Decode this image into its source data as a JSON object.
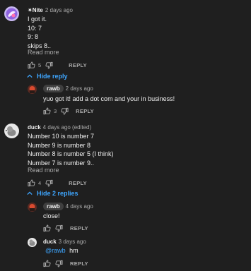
{
  "comments": [
    {
      "author": "✷Nite",
      "time": "2 days ago",
      "lines": [
        "I got it.",
        "10: 7",
        "9: 8",
        "skips 8.."
      ],
      "read_more": "Read more",
      "likes": "5",
      "reply": "REPLY",
      "toggle": "Hide reply",
      "replies": [
        {
          "author": "rawb",
          "time": "2 days ago",
          "text": "yuo got it! add a dot com and your in business!",
          "likes": "3",
          "reply": "REPLY"
        }
      ]
    },
    {
      "author": "duck",
      "time": "4 days ago (edited)",
      "lines": [
        "Number 10 is number 7",
        "Number 9 is number 8",
        "Number 8 is number 5 (I think)",
        "Number 7 is number 9.."
      ],
      "read_more": "Read more",
      "likes": "4",
      "reply": "REPLY",
      "toggle": "Hide 2 replies",
      "replies": [
        {
          "author": "rawb",
          "time": "4 days ago",
          "text": "close!",
          "likes": "",
          "reply": "REPLY"
        },
        {
          "author": "duck",
          "time": "3 days ago",
          "mention": "@rawb",
          "text": "hm",
          "likes": "",
          "reply": "REPLY"
        }
      ]
    }
  ],
  "colors": {
    "background": "#1f1f1f",
    "link": "#3ea6ff",
    "muted": "#aaaaaa",
    "text": "#f1f1f1"
  },
  "icons": [
    "thumb-up-icon",
    "thumb-down-icon",
    "chevron-up-icon"
  ]
}
